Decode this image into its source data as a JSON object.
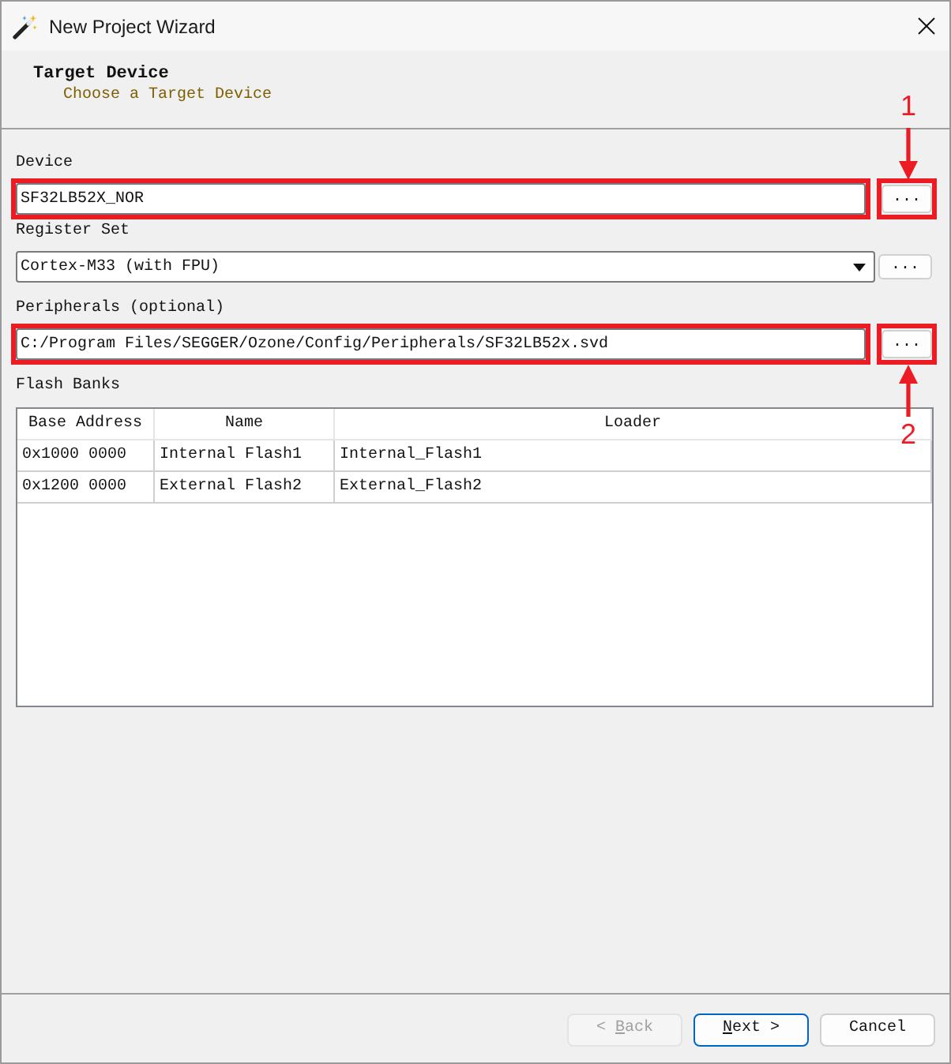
{
  "window": {
    "title": "New Project Wizard"
  },
  "header": {
    "title": "Target Device",
    "subtitle": "Choose a Target Device"
  },
  "fields": [
    {
      "kind": "text",
      "label": "Device",
      "value": "SF32LB52X_NOR",
      "button": "...",
      "highlighted": true
    },
    {
      "kind": "dropdown",
      "label": "Register Set",
      "value": "Cortex-M33 (with FPU)",
      "button": "...",
      "highlighted": false
    },
    {
      "kind": "text",
      "label": "Peripherals (optional)",
      "value": "C:/Program Files/SEGGER/Ozone/Config/Peripherals/SF32LB52x.svd",
      "button": "...",
      "highlighted": true
    }
  ],
  "flash_banks": {
    "label": "Flash Banks",
    "columns": [
      "Base Address",
      "Name",
      "Loader"
    ],
    "rows": [
      [
        "0x1000 0000",
        "Internal Flash1",
        "Internal_Flash1"
      ],
      [
        "0x1200 0000",
        "External Flash2",
        "External_Flash2"
      ]
    ]
  },
  "annotations": [
    {
      "kind": "arrow-down",
      "label": "1"
    },
    {
      "kind": "arrow-up",
      "label": "2"
    }
  ],
  "buttons": [
    {
      "text_before": "< ",
      "access_key": "B",
      "text_after": "ack",
      "disabled": true,
      "default": false
    },
    {
      "access_key": "N",
      "text_after": "ext >",
      "disabled": false,
      "default": true
    },
    {
      "text_before": "Cancel",
      "disabled": false,
      "default": false
    }
  ]
}
